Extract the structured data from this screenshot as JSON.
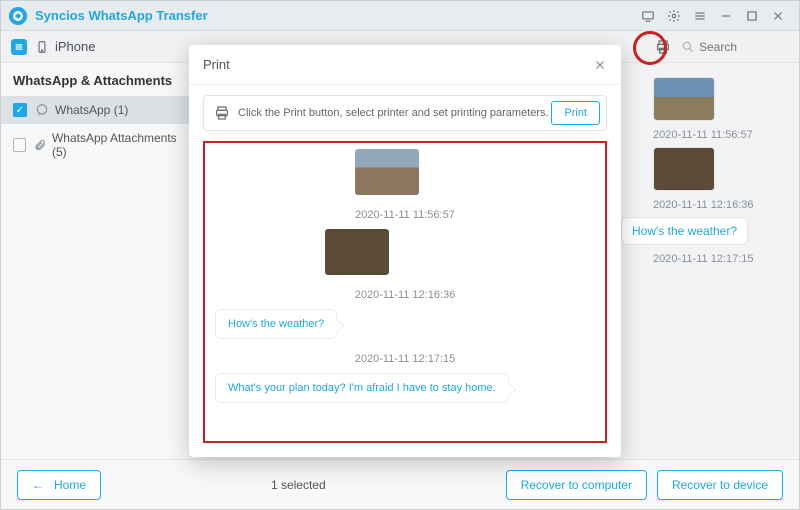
{
  "titlebar": {
    "app_name": "Syncios WhatsApp Transfer"
  },
  "device": {
    "name": "iPhone",
    "search_placeholder": "Search"
  },
  "sidebar": {
    "section": "WhatsApp & Attachments",
    "items": [
      {
        "label": "WhatsApp (1)",
        "checked": true
      },
      {
        "label": "WhatsApp Attachments (5)",
        "checked": false
      }
    ]
  },
  "footer": {
    "home": "Home",
    "selected": "1 selected",
    "recover_computer": "Recover to computer",
    "recover_device": "Recover to device"
  },
  "modal": {
    "title": "Print",
    "tip": "Click the Print button, select printer and set printing parameters.",
    "print_btn": "Print"
  },
  "messages": {
    "preview": [
      {
        "type": "image",
        "variant": "sky"
      },
      {
        "type": "ts",
        "text": "2020-11-11 11:56:57"
      },
      {
        "type": "image",
        "variant": "brown"
      },
      {
        "type": "ts",
        "text": "2020-11-11 12:16:36"
      },
      {
        "type": "text",
        "text": "How's the weather?"
      },
      {
        "type": "ts",
        "text": "2020-11-11 12:17:15"
      },
      {
        "type": "text",
        "text": "What's your plan today? I'm afraid I have to stay home."
      }
    ],
    "background": [
      {
        "type": "image",
        "variant": "sky"
      },
      {
        "type": "ts",
        "text": "2020-11-11 11:56:57"
      },
      {
        "type": "image",
        "variant": "brown"
      },
      {
        "type": "ts",
        "text": "2020-11-11 12:16:36"
      },
      {
        "type": "text",
        "text": "How's the weather?"
      },
      {
        "type": "ts",
        "text": "2020-11-11 12:17:15"
      }
    ]
  }
}
